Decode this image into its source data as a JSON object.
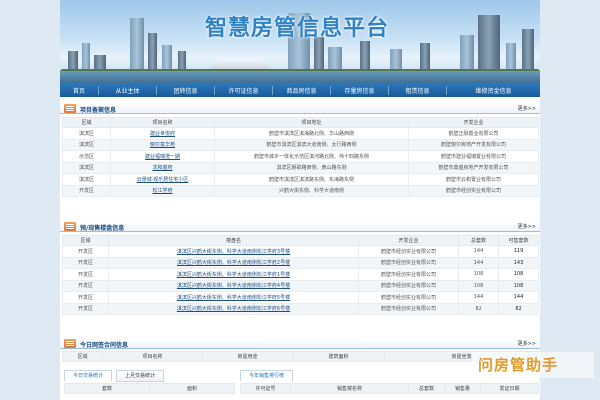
{
  "site_title": "智慧房管信息平台",
  "nav": [
    "首页",
    "从业主体",
    "团转信息",
    "许可证信息",
    "商品房信息",
    "存量房信息",
    "租赁信息",
    "维修资金信息"
  ],
  "section1": {
    "title": "项目备案信息",
    "more": "更多>>",
    "headers": [
      "区域",
      "项目名称",
      "项目地址",
      "开发企业"
    ],
    "rows": [
      [
        "淇滨区",
        "建业世悦府",
        "鹤壁市淇滨区淇海路北侧、华山路西侧",
        "鹤壁正融置业有限公司"
      ],
      [
        "淇滨区",
        "俪尔富华苑",
        "鹤壁市淇滨区淇滨大道南侧、太行路西侧",
        "鹤壁俪尔房地产开发有限公司"
      ],
      [
        "示范区",
        "建业福瑞澄一期",
        "鹤壁市城乡一体化示范区淇河路北侧、伟十四路东侧",
        "鹤壁市建业福瑞置业有限公司"
      ],
      [
        "淇滨区",
        "龙和盛府",
        "淇滨区朝歌路西侧、黄山路东侧",
        "鹤壁市鼎盛房地产开发有限公司"
      ],
      [
        "淇滨区",
        "云景城·观乐居住宅小区",
        "鹤壁市淇滨区淇滨路东侧、东海路东侧",
        "鹤壁市云和置业有限公司"
      ],
      [
        "开发区",
        "松江学府",
        "兴鹤大街东侧、科学大道南侧",
        "鹤壁市经创实业有限公司"
      ]
    ]
  },
  "section2": {
    "title": "预/现售楼盘信息",
    "more": "更多>>",
    "headers": [
      "区域",
      "楼盘名",
      "开发企业",
      "总套数",
      "可售套数"
    ],
    "rows": [
      [
        "开发区",
        "淇滨区兴鹤大街东侧、科学大道南侧松江学府3号楼",
        "鹤壁市经创实业有限公司",
        "144",
        "119"
      ],
      [
        "开发区",
        "淇滨区兴鹤大街东侧、科学大道南侧松江学府2号楼",
        "鹤壁市经创实业有限公司",
        "144",
        "143"
      ],
      [
        "开发区",
        "淇滨区兴鹤大街东侧、科学大道南侧松江学府1号楼",
        "鹤壁市经创实业有限公司",
        "108",
        "108"
      ],
      [
        "开发区",
        "淇滨区兴鹤大街东侧、科学大道南侧松江学府4号楼",
        "鹤壁市经创实业有限公司",
        "108",
        "108"
      ],
      [
        "开发区",
        "淇滨区兴鹤大街东侧、科学大道南侧松江学府5号楼",
        "鹤壁市经创实业有限公司",
        "144",
        "144"
      ],
      [
        "开发区",
        "淇滨区兴鹤大街东侧、科学大道南侧松江学府6号楼",
        "鹤壁市经创实业有限公司",
        "82",
        "82"
      ]
    ]
  },
  "section3": {
    "title": "今日网签合同信息",
    "more": "更多>>",
    "headers": [
      "区域",
      "项目名称",
      "房屋用途",
      "建筑面积",
      "房屋坐落"
    ]
  },
  "tabs_left": [
    "今日交易统计",
    "上月交易统计"
  ],
  "left_cols": [
    "套数",
    "面积"
  ],
  "tabs_right": [
    "今年销售排行榜"
  ],
  "right_cols": [
    "许可证号",
    "销售楼名称",
    "总套数",
    "销售量",
    "发证日期"
  ],
  "watermark": "问房管助手",
  "colors": {
    "nav": "#2b79bd",
    "title": "#2f83c6",
    "accent_orange": "#e39a2a"
  }
}
